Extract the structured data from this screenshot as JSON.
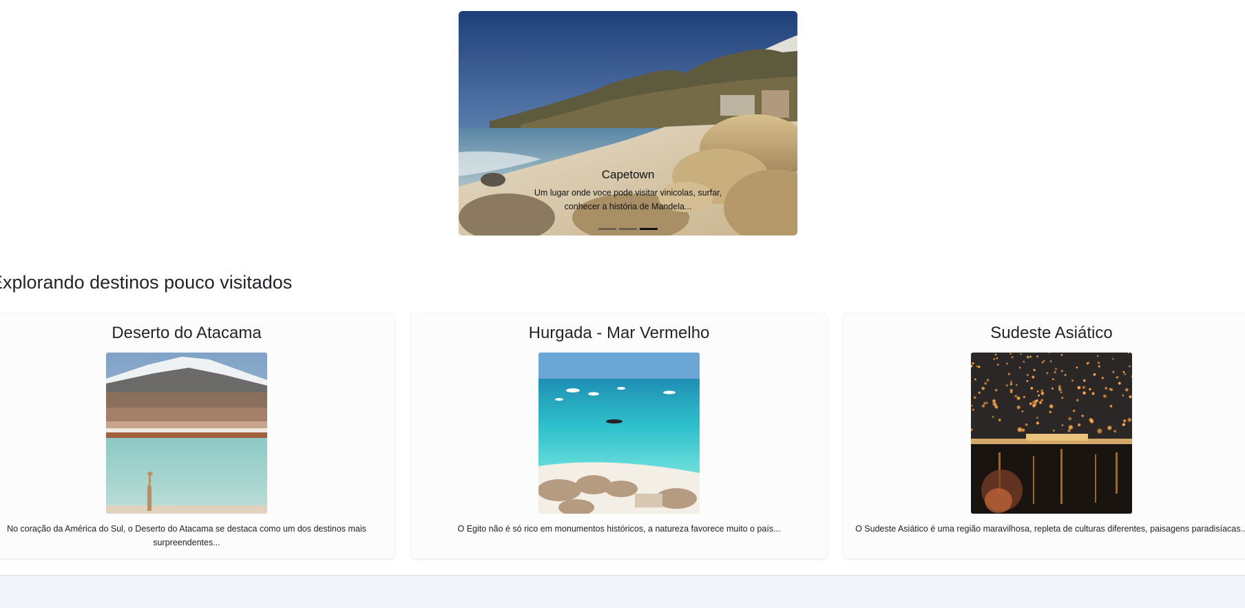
{
  "carousel": {
    "slide_title": "Capetown",
    "slide_text": "Um lugar onde voce pode visitar vinicolas, surfar, conhecer a história de Mandela...",
    "active_indicator": 3,
    "indicator_count": 3
  },
  "section": {
    "title": "Explorando destinos pouco visitados"
  },
  "cards": [
    {
      "title": "Deserto do Atacama",
      "text": "No coração da América do Sul, o Deserto do Atacama se destaca como um dos destinos mais surpreendentes..."
    },
    {
      "title": "Hurgada - Mar Vermelho",
      "text": "O Egito não é só rico em monumentos históricos, a natureza favorece muito o país..."
    },
    {
      "title": "Sudeste Asiático",
      "text": "O Sudeste Asiático é uma região maravilhosa, repleta de culturas diferentes, paisagens paradisíacas..."
    }
  ]
}
